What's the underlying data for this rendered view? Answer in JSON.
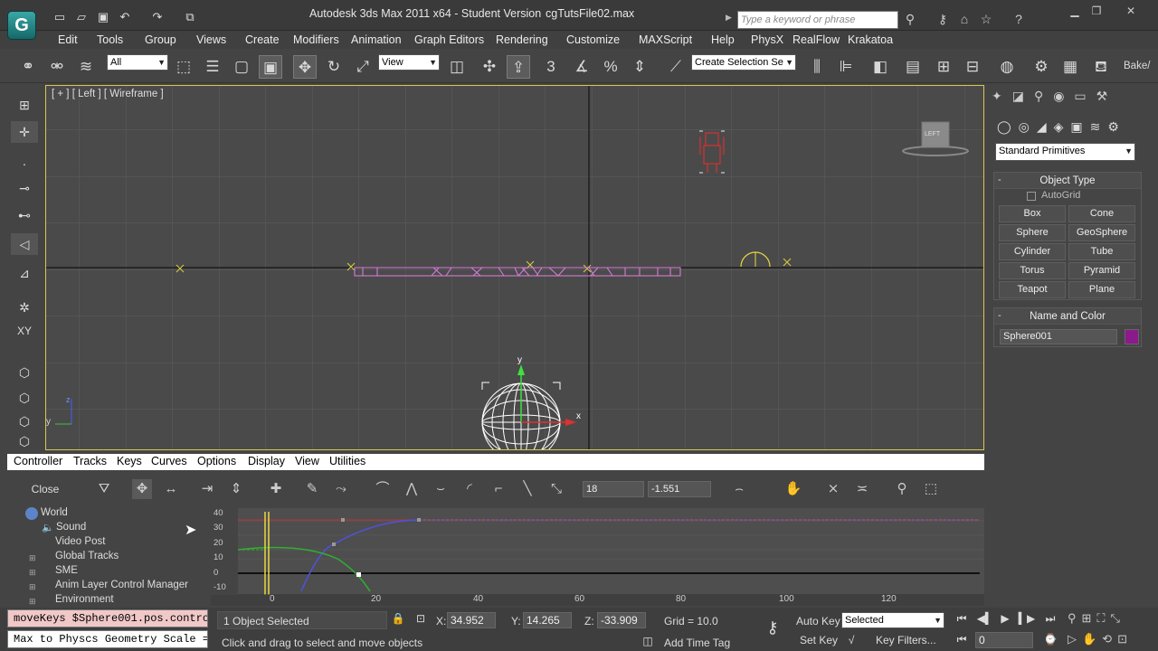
{
  "app": {
    "title": "Autodesk 3ds Max  2011 x64  -  Student Version",
    "file": "cgTutsFile02.max",
    "logo": "G",
    "search_placeholder": "Type a keyword or phrase"
  },
  "menu": [
    "Edit",
    "Tools",
    "Group",
    "Views",
    "Create",
    "Modifiers",
    "Animation",
    "Graph Editors",
    "Rendering",
    "Customize",
    "MAXScript",
    "Help",
    "PhysX",
    "RealFlow",
    "Krakatoa"
  ],
  "main_toolbar": {
    "selection_filter": "All",
    "ref_coord": "View",
    "snap_3d": "3",
    "named_selection_placeholder": "Create Selection Se",
    "bake_label": "Bake/"
  },
  "viewport": {
    "label": "[ + ] [ Left ] [ Wireframe ]",
    "viewcube_label": "LEFT",
    "axis_y": "y",
    "axis_z": "z",
    "gizmo_y": "y",
    "gizmo_x": "x"
  },
  "command_panel": {
    "category_dropdown": "Standard Primitives",
    "object_type_title": "Object Type",
    "autogrid_label": "AutoGrid",
    "primitive_buttons": [
      "Box",
      "Cone",
      "Sphere",
      "GeoSphere",
      "Cylinder",
      "Tube",
      "Torus",
      "Pyramid",
      "Teapot",
      "Plane"
    ],
    "name_color_title": "Name and Color",
    "object_name": "Sphere001",
    "object_color": "#8b1a8b"
  },
  "curve_editor": {
    "menu": [
      "Controller",
      "Tracks",
      "Keys",
      "Curves",
      "Options",
      "Display",
      "View",
      "Utilities"
    ],
    "close_label": "Close",
    "frame_field": "18",
    "value_field": "-1.551",
    "tree": [
      "World",
      "Sound",
      "Video Post",
      "Global Tracks",
      "SME",
      "Anim Layer Control Manager",
      "Environment"
    ],
    "y_ticks": [
      "40",
      "30",
      "20",
      "10",
      "0",
      "-10"
    ],
    "x_ticks": [
      "0",
      "20",
      "40",
      "60",
      "80",
      "100",
      "120"
    ]
  },
  "status": {
    "listener_line1": "moveKeys $Sphere001.pos.contro",
    "listener_line2": "Max to Physcs Geometry Scale =",
    "selected_text": "1 Object Selected",
    "prompt_text": "Click and drag to select and move objects",
    "x_label": "X:",
    "x_value": "34.952",
    "y_label": "Y:",
    "y_value": "14.265",
    "z_label": "Z:",
    "z_value": "-33.909",
    "grid_text": "Grid = 10.0",
    "add_time_tag": "Add Time Tag",
    "auto_key": "Auto Key",
    "set_key": "Set Key",
    "key_mode": "Selected",
    "key_filters": "Key Filters...",
    "frame_value": "0"
  }
}
